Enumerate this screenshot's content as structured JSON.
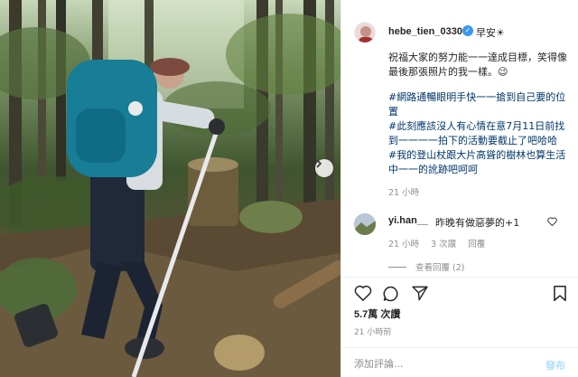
{
  "post": {
    "username": "hebe_tien_0330",
    "greeting": "早安☀︎",
    "caption_line1": "祝福大家的努力能一一達成目標，笑得像最後那張照片的我一樣。😉",
    "tags": [
      "#網路通暢眼明手快一一搶到自己要的位置",
      "#此刻應該沒人有心情在意7月11日前找到一一一一拍下的活動要截止了吧哈哈",
      "#我的登山杖跟大片高聳的樹林也算生活中一一的訛跡吧呵呵"
    ],
    "time": "21 小時"
  },
  "comment": {
    "username": "yi.han__",
    "text": "昨晚有做惡夢的+1",
    "time": "21 小時",
    "likes": "3 次讚",
    "reply": "回覆",
    "view_replies": "查看回覆 (2)"
  },
  "footer": {
    "likes": "5.7萬 次讚",
    "time": "21 小時前",
    "comment_placeholder": "添加評論...",
    "post_button": "發布"
  },
  "icons": {
    "verified": "verified-badge-icon",
    "like": "heart-icon",
    "comment": "comment-bubble-icon",
    "share": "paper-plane-icon",
    "save": "bookmark-icon",
    "next": "chevron-right-icon"
  },
  "colors": {
    "verified_blue": "#3897f0",
    "hashtag": "#00376b",
    "muted": "#8e8e8e",
    "post_button_disabled": "#b2dffc"
  }
}
